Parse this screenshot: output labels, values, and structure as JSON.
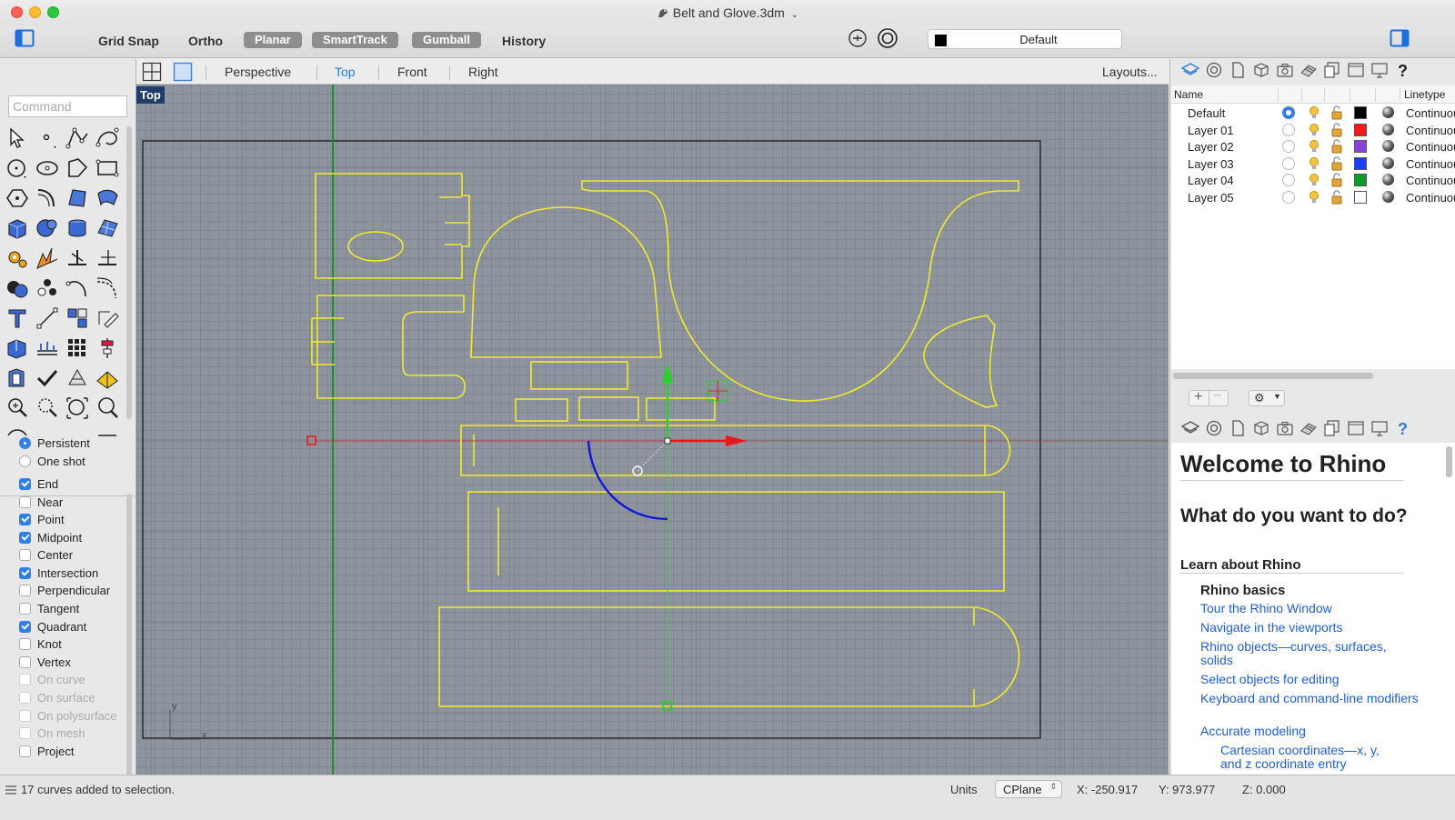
{
  "window": {
    "title": "Belt and Glove.3dm"
  },
  "toolbar": {
    "grid_snap": "Grid Snap",
    "ortho": "Ortho",
    "planar": "Planar",
    "smarttrack": "SmartTrack",
    "gumball": "Gumball",
    "history": "History",
    "current_layer": "Default"
  },
  "command": {
    "placeholder": "Command"
  },
  "osnap": {
    "modes": [
      {
        "label": "Persistent",
        "selected": true
      },
      {
        "label": "One shot",
        "selected": false
      }
    ],
    "items": [
      {
        "label": "End",
        "checked": true,
        "enabled": true
      },
      {
        "label": "Near",
        "checked": false,
        "enabled": true
      },
      {
        "label": "Point",
        "checked": true,
        "enabled": true
      },
      {
        "label": "Midpoint",
        "checked": true,
        "enabled": true
      },
      {
        "label": "Center",
        "checked": false,
        "enabled": true
      },
      {
        "label": "Intersection",
        "checked": true,
        "enabled": true
      },
      {
        "label": "Perpendicular",
        "checked": false,
        "enabled": true
      },
      {
        "label": "Tangent",
        "checked": false,
        "enabled": true
      },
      {
        "label": "Quadrant",
        "checked": true,
        "enabled": true
      },
      {
        "label": "Knot",
        "checked": false,
        "enabled": true
      },
      {
        "label": "Vertex",
        "checked": false,
        "enabled": true
      },
      {
        "label": "On curve",
        "checked": false,
        "enabled": false
      },
      {
        "label": "On surface",
        "checked": false,
        "enabled": false
      },
      {
        "label": "On polysurface",
        "checked": false,
        "enabled": false
      },
      {
        "label": "On mesh",
        "checked": false,
        "enabled": false
      },
      {
        "label": "Project",
        "checked": false,
        "enabled": true
      }
    ]
  },
  "viewports": {
    "tabs": [
      "Perspective",
      "Top",
      "Front",
      "Right"
    ],
    "active": "Top",
    "layouts": "Layouts...",
    "active_label": "Top",
    "axis_y": "y",
    "axis_x": "x"
  },
  "layers": {
    "header_name": "Name",
    "header_linetype": "Linetype",
    "rows": [
      {
        "name": "Default",
        "current": true,
        "color": "#000000",
        "linetype": "Continuous"
      },
      {
        "name": "Layer 01",
        "current": false,
        "color": "#ff1a1a",
        "linetype": "Continuous"
      },
      {
        "name": "Layer 02",
        "current": false,
        "color": "#8a3fe0",
        "linetype": "Continuous"
      },
      {
        "name": "Layer 03",
        "current": false,
        "color": "#1a3cff",
        "linetype": "Continuous"
      },
      {
        "name": "Layer 04",
        "current": false,
        "color": "#0c9a2a",
        "linetype": "Continuous"
      },
      {
        "name": "Layer 05",
        "current": false,
        "color": "#ffffff",
        "linetype": "Continuous"
      }
    ]
  },
  "welcome": {
    "title": "Welcome to Rhino",
    "question": "What do you want to do?",
    "learn_heading": "Learn about Rhino",
    "basics_heading": "Rhino basics",
    "links": [
      "Tour the Rhino Window",
      "Navigate in the viewports",
      "Rhino objects—curves, surfaces, solids",
      "Select objects for editing",
      "Keyboard and command-line modifiers",
      "Accurate modeling"
    ],
    "sublink": "Cartesian coordinates—x, y, and z coordinate entry"
  },
  "status": {
    "message": "17 curves added to selection.",
    "units": "Units",
    "cplane": "CPlane",
    "x": "X: -250.917",
    "y": "Y: 973.977",
    "z": "Z: 0.000"
  },
  "colors": {
    "curve": "#f2ea2b",
    "viewport_bg": "#8d949e",
    "accent": "#2b7bd8",
    "gumball_x": "#e8191b",
    "gumball_y": "#2bd12b",
    "gumball_rotate": "#1018d8"
  }
}
